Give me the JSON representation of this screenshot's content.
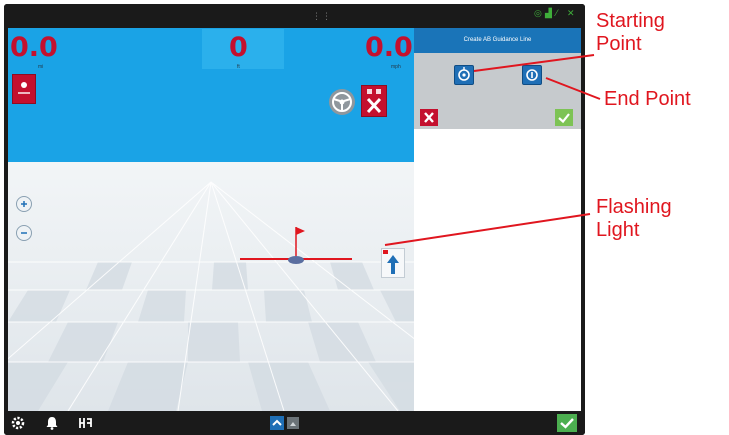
{
  "header": {
    "speed_left": "0.0",
    "speed_left_unit": "mi",
    "center_value": "0",
    "center_unit": "ft",
    "speed_right": "0.0",
    "speed_right_unit": "mph"
  },
  "panel": {
    "title": "Create AB Guidance Line",
    "start_point_icon": "target-start-icon",
    "end_point_icon": "target-end-icon",
    "cancel_icon": "close-icon",
    "accept_icon": "check-icon"
  },
  "map": {
    "zoom_in_icon": "zoom-in-icon",
    "zoom_out_icon": "zoom-out-icon",
    "steering_icon": "steering-wheel-icon",
    "flag_icon": "flag-icon",
    "direction_icon": "up-arrow-icon"
  },
  "bottom_bar": {
    "settings_icon": "gear-icon",
    "alerts_icon": "bell-icon",
    "implement_icon": "implement-icon",
    "up_icon": "chevron-up-icon",
    "confirm_icon": "check-icon"
  },
  "callouts": {
    "starting_point_line1": "Starting",
    "starting_point_line2": "Point",
    "end_point": "End Point",
    "flashing_light_line1": "Flashing",
    "flashing_light_line2": "Light"
  },
  "colors": {
    "accent_red": "#e0161f",
    "sky_blue": "#1aa3e6",
    "readout_red": "#c4102e",
    "confirm_green": "#4caf50",
    "header_blue": "#1a74b8"
  }
}
